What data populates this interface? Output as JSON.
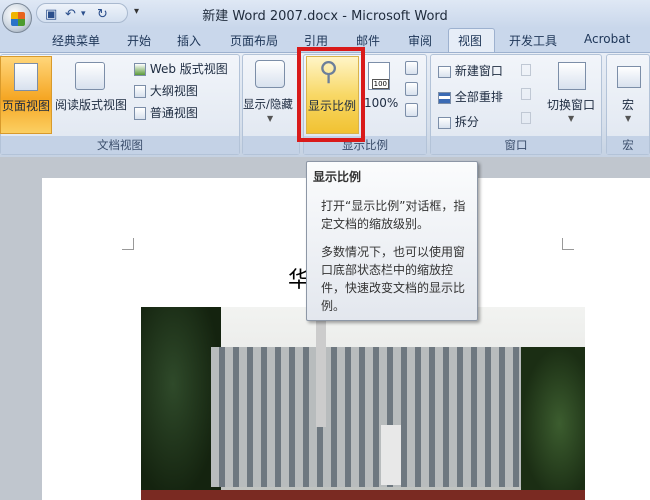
{
  "window": {
    "title": "新建 Word 2007.docx - Microsoft Word"
  },
  "qat": {
    "customize": "▾"
  },
  "tabs": [
    "经典菜单",
    "开始",
    "插入",
    "页面布局",
    "引用",
    "邮件",
    "审阅",
    "视图",
    "开发工具",
    "Acrobat"
  ],
  "groups": {
    "doc_views": {
      "label": "文档视图",
      "page_view": "页面视图",
      "reading_view": "阅读版式视图",
      "web_view": "Web 版式视图",
      "outline_view": "大纲视图",
      "draft_view": "普通视图"
    },
    "show_hide": {
      "label": "显示/隐藏"
    },
    "zoom": {
      "label": "显示比例",
      "zoom": "显示比例",
      "hundred": "100%",
      "hundred_icon_text": "100"
    },
    "window": {
      "label": "窗口",
      "new_window": "新建窗口",
      "arrange_all": "全部重排",
      "split": "拆分",
      "switch_windows": "切换窗口"
    },
    "macros": {
      "label": "宏",
      "macros": "宏"
    }
  },
  "tooltip": {
    "title": "显示比例",
    "p1": "打开“显示比例”对话框，指定文档的缩放级别。",
    "p2": "多数情况下，也可以使用窗口底部状态栏中的缩放控件，快速改变文档的显示比例。"
  },
  "document": {
    "heading_fragment": "华"
  }
}
